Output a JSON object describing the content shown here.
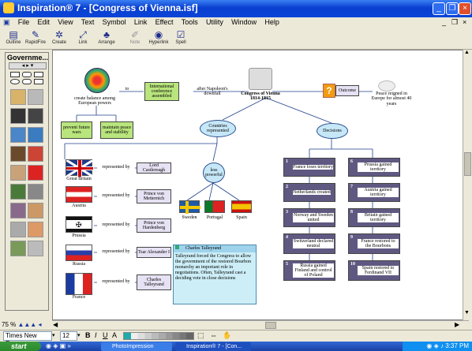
{
  "window": {
    "title": "Inspiration® 7 - [Congress of Vienna.isf]"
  },
  "menu": [
    "File",
    "Edit",
    "View",
    "Text",
    "Symbol",
    "Link",
    "Effect",
    "Tools",
    "Utility",
    "Window",
    "Help"
  ],
  "toolbar": [
    {
      "label": "Outline",
      "icon": "outline-icon"
    },
    {
      "label": "RapidFire",
      "icon": "rapidfire-icon"
    },
    {
      "label": "Create",
      "icon": "create-icon"
    },
    {
      "label": "Link",
      "icon": "link-icon"
    },
    {
      "label": "Arrange",
      "icon": "arrange-icon"
    },
    {
      "label": "Note",
      "icon": "note-icon"
    },
    {
      "label": "Hyperlink",
      "icon": "hyperlink-icon"
    },
    {
      "label": "Spell",
      "icon": "spell-icon"
    }
  ],
  "palette": {
    "title": "Governme..."
  },
  "diagram": {
    "main_topic": "Congress of Vienna 1814-1815",
    "napoleon": "after Napoleon's downfall",
    "conference": "International conference assembled",
    "to_label": "to",
    "create_balance": "create balance among European powers",
    "prevent_wars": "prevent future wars",
    "maintain_peace": "maintain peace and stability",
    "outcome": "Outcome",
    "peace": "Peace reigned in Europe for almost 40 years",
    "countries": "Countries represented",
    "decisions": "Decisions",
    "less_powerful": "less powerful",
    "represented_by": "represented by",
    "countries_list": [
      {
        "name": "Great Britain",
        "rep": "Lord Castlereagh"
      },
      {
        "name": "Austria",
        "rep": "Prince von Metternich"
      },
      {
        "name": "Prussia",
        "rep": "Prince von Hardenberg"
      },
      {
        "name": "Russia",
        "rep": "Tsar Alexander I"
      },
      {
        "name": "France",
        "rep": "Charles Talleyrand"
      }
    ],
    "small_countries": [
      "Sweden",
      "Portugal",
      "Spain"
    ],
    "decisions_left": [
      {
        "num": "1",
        "text": "France loses territory"
      },
      {
        "num": "2",
        "text": "Netherlands created"
      },
      {
        "num": "3",
        "text": "Norway and Sweden united"
      },
      {
        "num": "4",
        "text": "Switzerland declared neutral"
      },
      {
        "num": "5",
        "text": "Russia gained Finland and control of Poland"
      }
    ],
    "decisions_right": [
      {
        "num": "6",
        "text": "Prussia gained territory"
      },
      {
        "num": "7",
        "text": "Austria gained territory"
      },
      {
        "num": "8",
        "text": "Britain gained territory"
      },
      {
        "num": "9",
        "text": "France restored to the Bourbons"
      },
      {
        "num": "10",
        "text": "Spain restored to Ferdinand VII"
      }
    ],
    "note": {
      "title": "Charles Talleyrand",
      "body": "Talleyrand forced the Congress to allow the government of the restored Bourbon monarchy an important role in negotiations. Often, Talleyrand cast a deciding vote in close decisions"
    }
  },
  "statusbar": {
    "zoom": "75 %"
  },
  "format": {
    "font": "Times New Roman",
    "size": "12"
  },
  "taskbar": {
    "start": "start",
    "tasks": [
      "PhotoImpression",
      "Inspiration® 7 - [Con..."
    ],
    "clock": "3:37 PM"
  }
}
